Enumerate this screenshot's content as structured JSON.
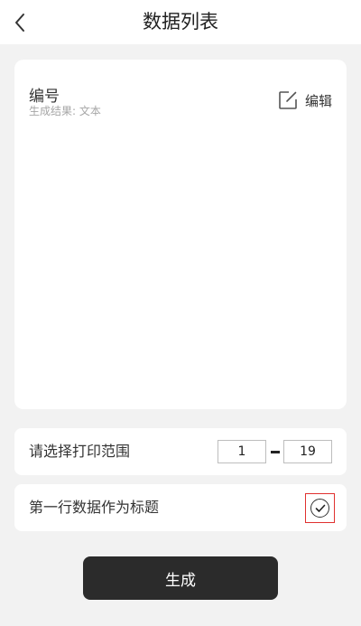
{
  "header": {
    "title": "数据列表",
    "back_icon": "chevron-left-icon"
  },
  "card": {
    "field_name": "编号",
    "field_subtitle": "生成结果: 文本",
    "edit_label": "编辑",
    "edit_icon": "edit-icon"
  },
  "range": {
    "label": "请选择打印范围",
    "start": "1",
    "end": "19"
  },
  "header_row": {
    "label": "第一行数据作为标题",
    "checked": true,
    "check_icon": "check-circle-icon"
  },
  "generate": {
    "label": "生成"
  },
  "colors": {
    "button_bg": "#2b2b2b",
    "highlight_border": "#e0312f",
    "background": "#f2f2f2"
  }
}
